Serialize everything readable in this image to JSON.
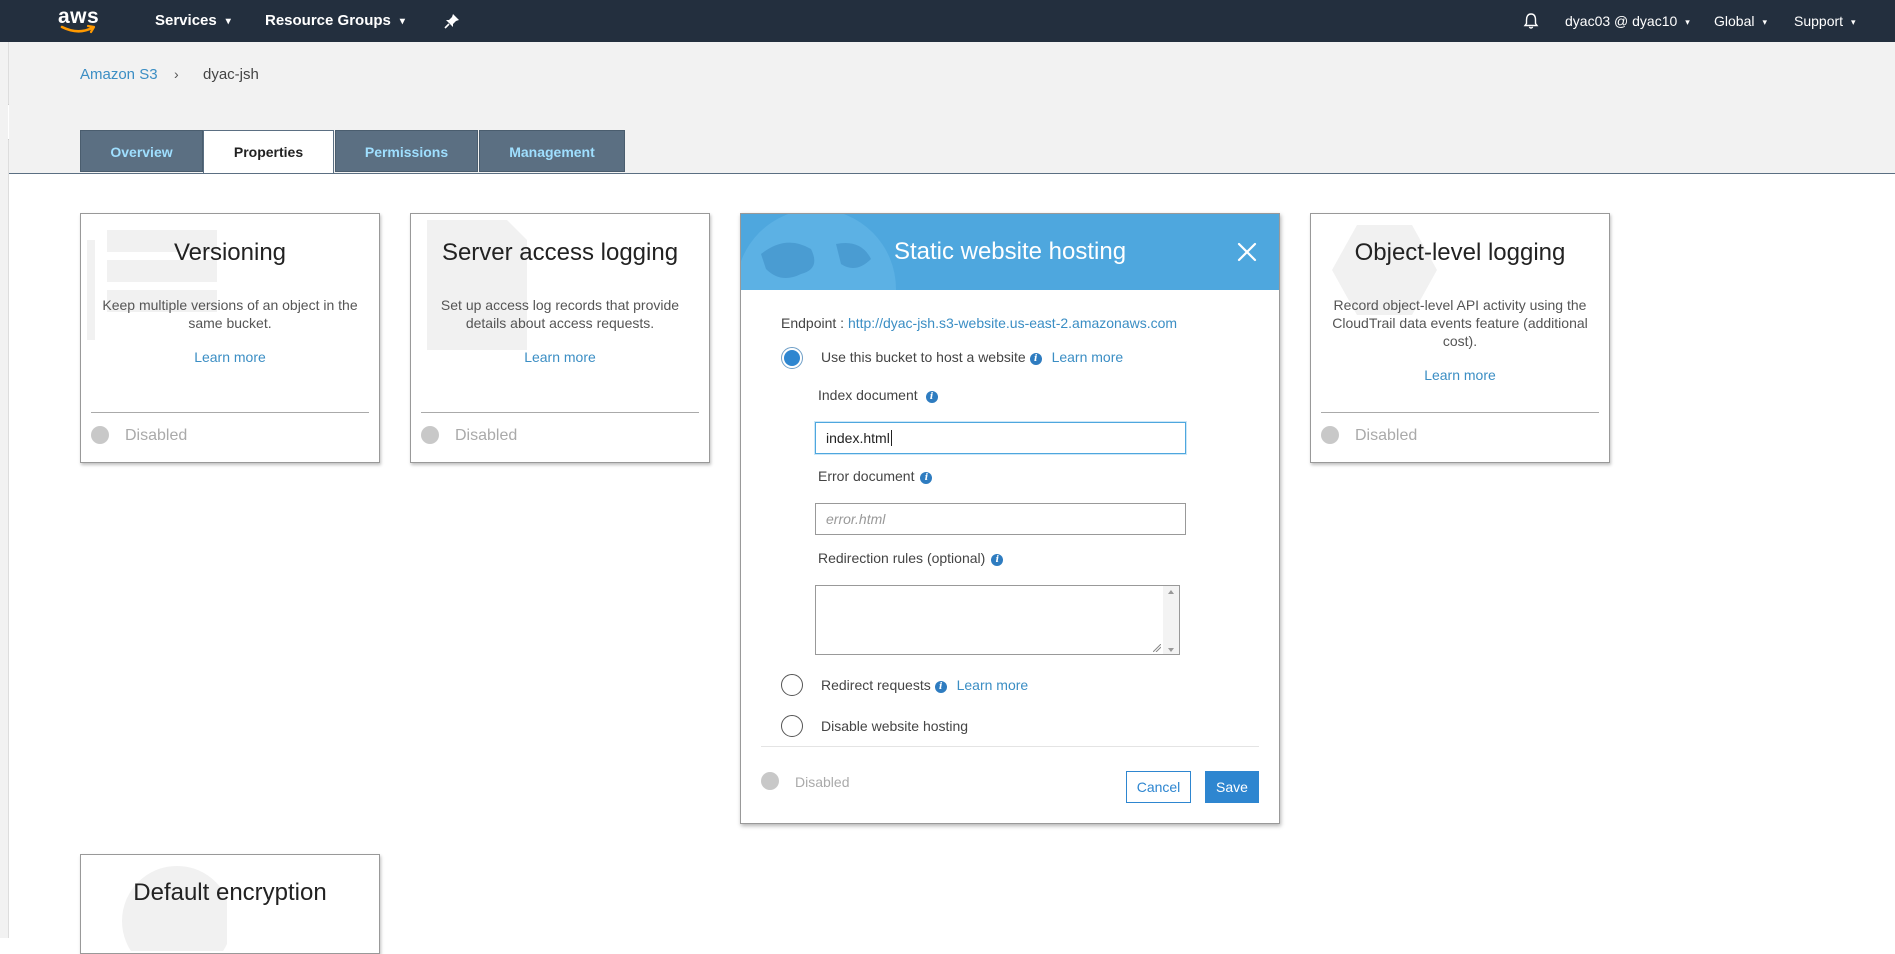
{
  "topnav": {
    "logo": "aws",
    "services": "Services",
    "resource_groups": "Resource Groups",
    "pin_icon": "pushpin-icon",
    "bell_icon": "bell-icon",
    "account": "dyac03 @ dyac10",
    "region": "Global",
    "support": "Support",
    "caret": "▾"
  },
  "breadcrumb": {
    "root": "Amazon S3",
    "separator": "›",
    "current": "dyac-jsh"
  },
  "tabs": [
    {
      "label": "Overview",
      "active": false
    },
    {
      "label": "Properties",
      "active": true
    },
    {
      "label": "Permissions",
      "active": false
    },
    {
      "label": "Management",
      "active": false
    }
  ],
  "cards": {
    "versioning": {
      "title": "Versioning",
      "description": "Keep multiple versions of an object in the same bucket.",
      "link": "Learn more",
      "status": "Disabled"
    },
    "server_access_logging": {
      "title": "Server access logging",
      "description": "Set up access log records that provide details about access requests.",
      "link": "Learn more",
      "status": "Disabled"
    },
    "object_level_logging": {
      "title": "Object-level logging",
      "description": "Record object-level API activity using the CloudTrail data events feature (additional cost).",
      "link": "Learn more",
      "status": "Disabled"
    },
    "default_encryption": {
      "title": "Default encryption"
    }
  },
  "modal": {
    "title": "Static website hosting",
    "endpoint_label": "Endpoint : ",
    "endpoint_url": "http://dyac-jsh.s3-website.us-east-2.amazonaws.com",
    "option_host": "Use this bucket to host a website",
    "learn_more": "Learn more",
    "index_label": "Index document",
    "index_value": "index.html",
    "error_label": "Error document",
    "error_placeholder": "error.html",
    "redirection_label": "Redirection rules (optional)",
    "option_redirect": "Redirect requests",
    "option_disable": "Disable website hosting",
    "status": "Disabled",
    "cancel": "Cancel",
    "save": "Save",
    "selected_option": "host"
  },
  "colors": {
    "nav_bg": "#232f3e",
    "modal_header": "#4ea7de",
    "link": "#3b8ec4",
    "primary_button": "#2e86d0",
    "tab_inactive": "#5b6f82"
  }
}
